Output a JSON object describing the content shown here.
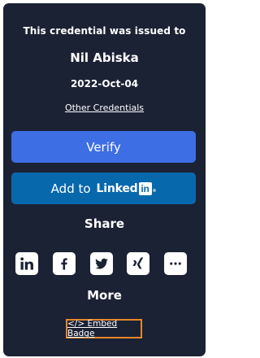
{
  "credential": {
    "issued_to_label": "This credential was issued to",
    "recipient_name": "Nil Abiska",
    "issue_date": "2022-Oct-04",
    "other_credentials_link": "Other Credentials"
  },
  "actions": {
    "verify_label": "Verify",
    "add_to_label": "Add to",
    "linkedin_word": "Linked",
    "linkedin_box": "in",
    "linkedin_reg": "®"
  },
  "share": {
    "title": "Share",
    "icons": [
      "linkedin-icon",
      "facebook-icon",
      "twitter-icon",
      "xing-icon",
      "more-options-icon"
    ]
  },
  "more": {
    "title": "More",
    "embed_badge_label": "</> Embed Badge"
  },
  "colors": {
    "card_background": "#1b2234",
    "verify_button": "#3d6ee4",
    "linkedin_button": "#0868ac",
    "embed_highlight_border": "#e8862a"
  }
}
